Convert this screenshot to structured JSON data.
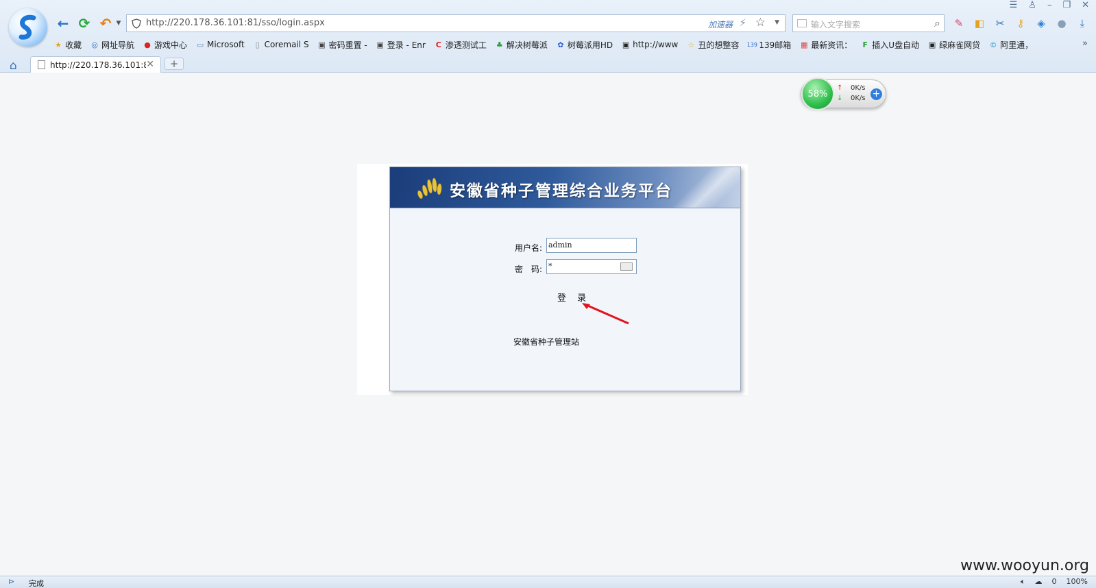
{
  "browser": {
    "address": "http://220.178.36.101:81/sso/login.aspx",
    "accelerator_label": "加速器",
    "search_placeholder": "输入文字搜索",
    "bookmarks": [
      {
        "label": "收藏",
        "icon": "star-icon"
      },
      {
        "label": "网址导航",
        "icon": "globe-icon"
      },
      {
        "label": "游戏中心",
        "icon": "game-icon"
      },
      {
        "label": "Microsoft",
        "icon": "folder-icon"
      },
      {
        "label": "Coremail S",
        "icon": "page-icon"
      },
      {
        "label": "密码重置 -",
        "icon": "image-icon"
      },
      {
        "label": "登录 - Enr",
        "icon": "image-icon"
      },
      {
        "label": "渗透测试工",
        "icon": "c-logo-icon"
      },
      {
        "label": "解决树莓派",
        "icon": "plant-icon"
      },
      {
        "label": "树莓派用HD",
        "icon": "paw-icon"
      },
      {
        "label": "http://www",
        "icon": "image-icon"
      },
      {
        "label": "丑的想整容",
        "icon": "star-icon"
      },
      {
        "label": "139邮箱",
        "icon": "mail139-icon"
      },
      {
        "label": "最新资讯：",
        "icon": "news-icon"
      },
      {
        "label": "插入U盘自动",
        "icon": "f-logo-icon"
      },
      {
        "label": "绿麻雀网贷",
        "icon": "image-icon"
      },
      {
        "label": "阿里通，",
        "icon": "ali-icon"
      }
    ],
    "tab": {
      "title": "http://220.178.36.101:8"
    },
    "new_tab_label": "+"
  },
  "speed_widget": {
    "percent": "58%",
    "up": "0K/s",
    "down": "0K/s"
  },
  "login": {
    "banner_title": "安徽省种子管理综合业务平台",
    "username_label": "用户名:",
    "username_value": "admin",
    "password_label": "密　码:",
    "password_value": "*",
    "login_button": "登 录",
    "org_name": "安徽省种子管理站"
  },
  "status_bar": {
    "state": "完成",
    "zoom": "100%",
    "counter": "0"
  },
  "watermark": "www.wooyun.org",
  "colors": {
    "banner": "#2f5a9b",
    "arrow": "#e0141e",
    "chrome": "#e9f1fa"
  }
}
